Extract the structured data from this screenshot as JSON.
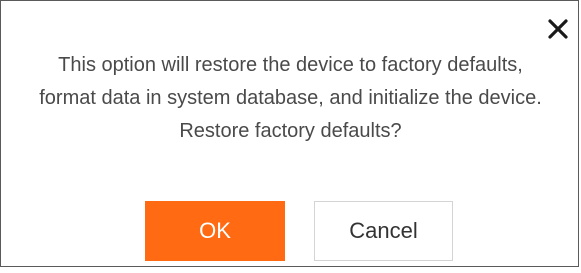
{
  "dialog": {
    "message": "This option will restore the device to factory defaults, format data in system database, and initialize the device. Restore factory defaults?",
    "close_icon": "close-icon",
    "ok_label": "OK",
    "cancel_label": "Cancel"
  },
  "colors": {
    "ok_background": "#ff6a13",
    "ok_text": "#ffffff",
    "cancel_border": "#d4d4d4",
    "message_text": "#4a4a4a",
    "dialog_border": "#5a5a5a"
  }
}
